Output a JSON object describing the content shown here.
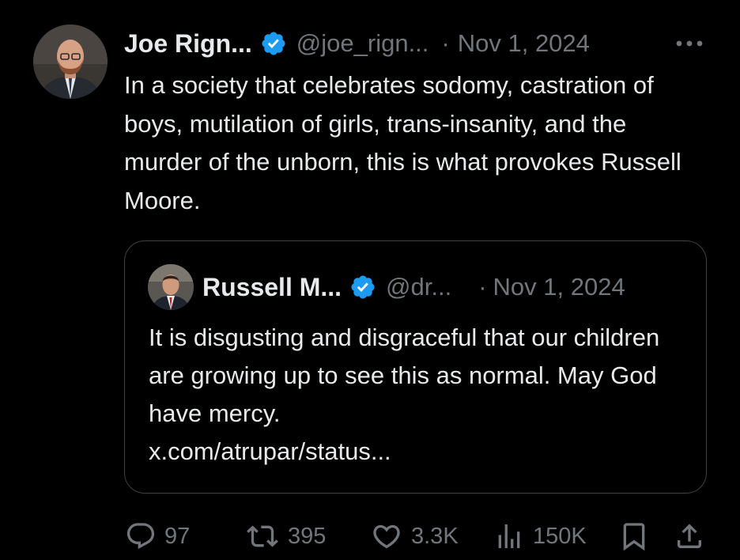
{
  "tweet": {
    "author_name": "Joe Rign...",
    "handle": "@joe_rign...",
    "separator": "·",
    "date": "Nov 1, 2024",
    "text": "In a society that celebrates sodomy, castration of boys, mutilation of girls, trans-insanity, and the murder of the unborn, this is what provokes Russell Moore."
  },
  "quoted_tweet": {
    "author_name": "Russell M...",
    "handle": "@dr...",
    "separator": "·",
    "date": "Nov 1, 2024",
    "text": "It is disgusting and disgraceful that our children are growing up to see this as normal. May God have mercy.",
    "link": "x.com/atrupar/status..."
  },
  "actions": {
    "replies": "97",
    "reposts": "395",
    "likes": "3.3K",
    "views": "150K"
  },
  "icons": {
    "verified": "verified-badge-icon",
    "more": "more-options-icon",
    "reply": "reply-icon",
    "repost": "repost-icon",
    "like": "heart-icon",
    "views": "views-icon",
    "bookmark": "bookmark-icon",
    "share": "share-icon"
  },
  "colors": {
    "background": "#000000",
    "text": "#e7e9ea",
    "secondary": "#71767b",
    "verified": "#1d9bf0",
    "border": "#3e4144"
  }
}
